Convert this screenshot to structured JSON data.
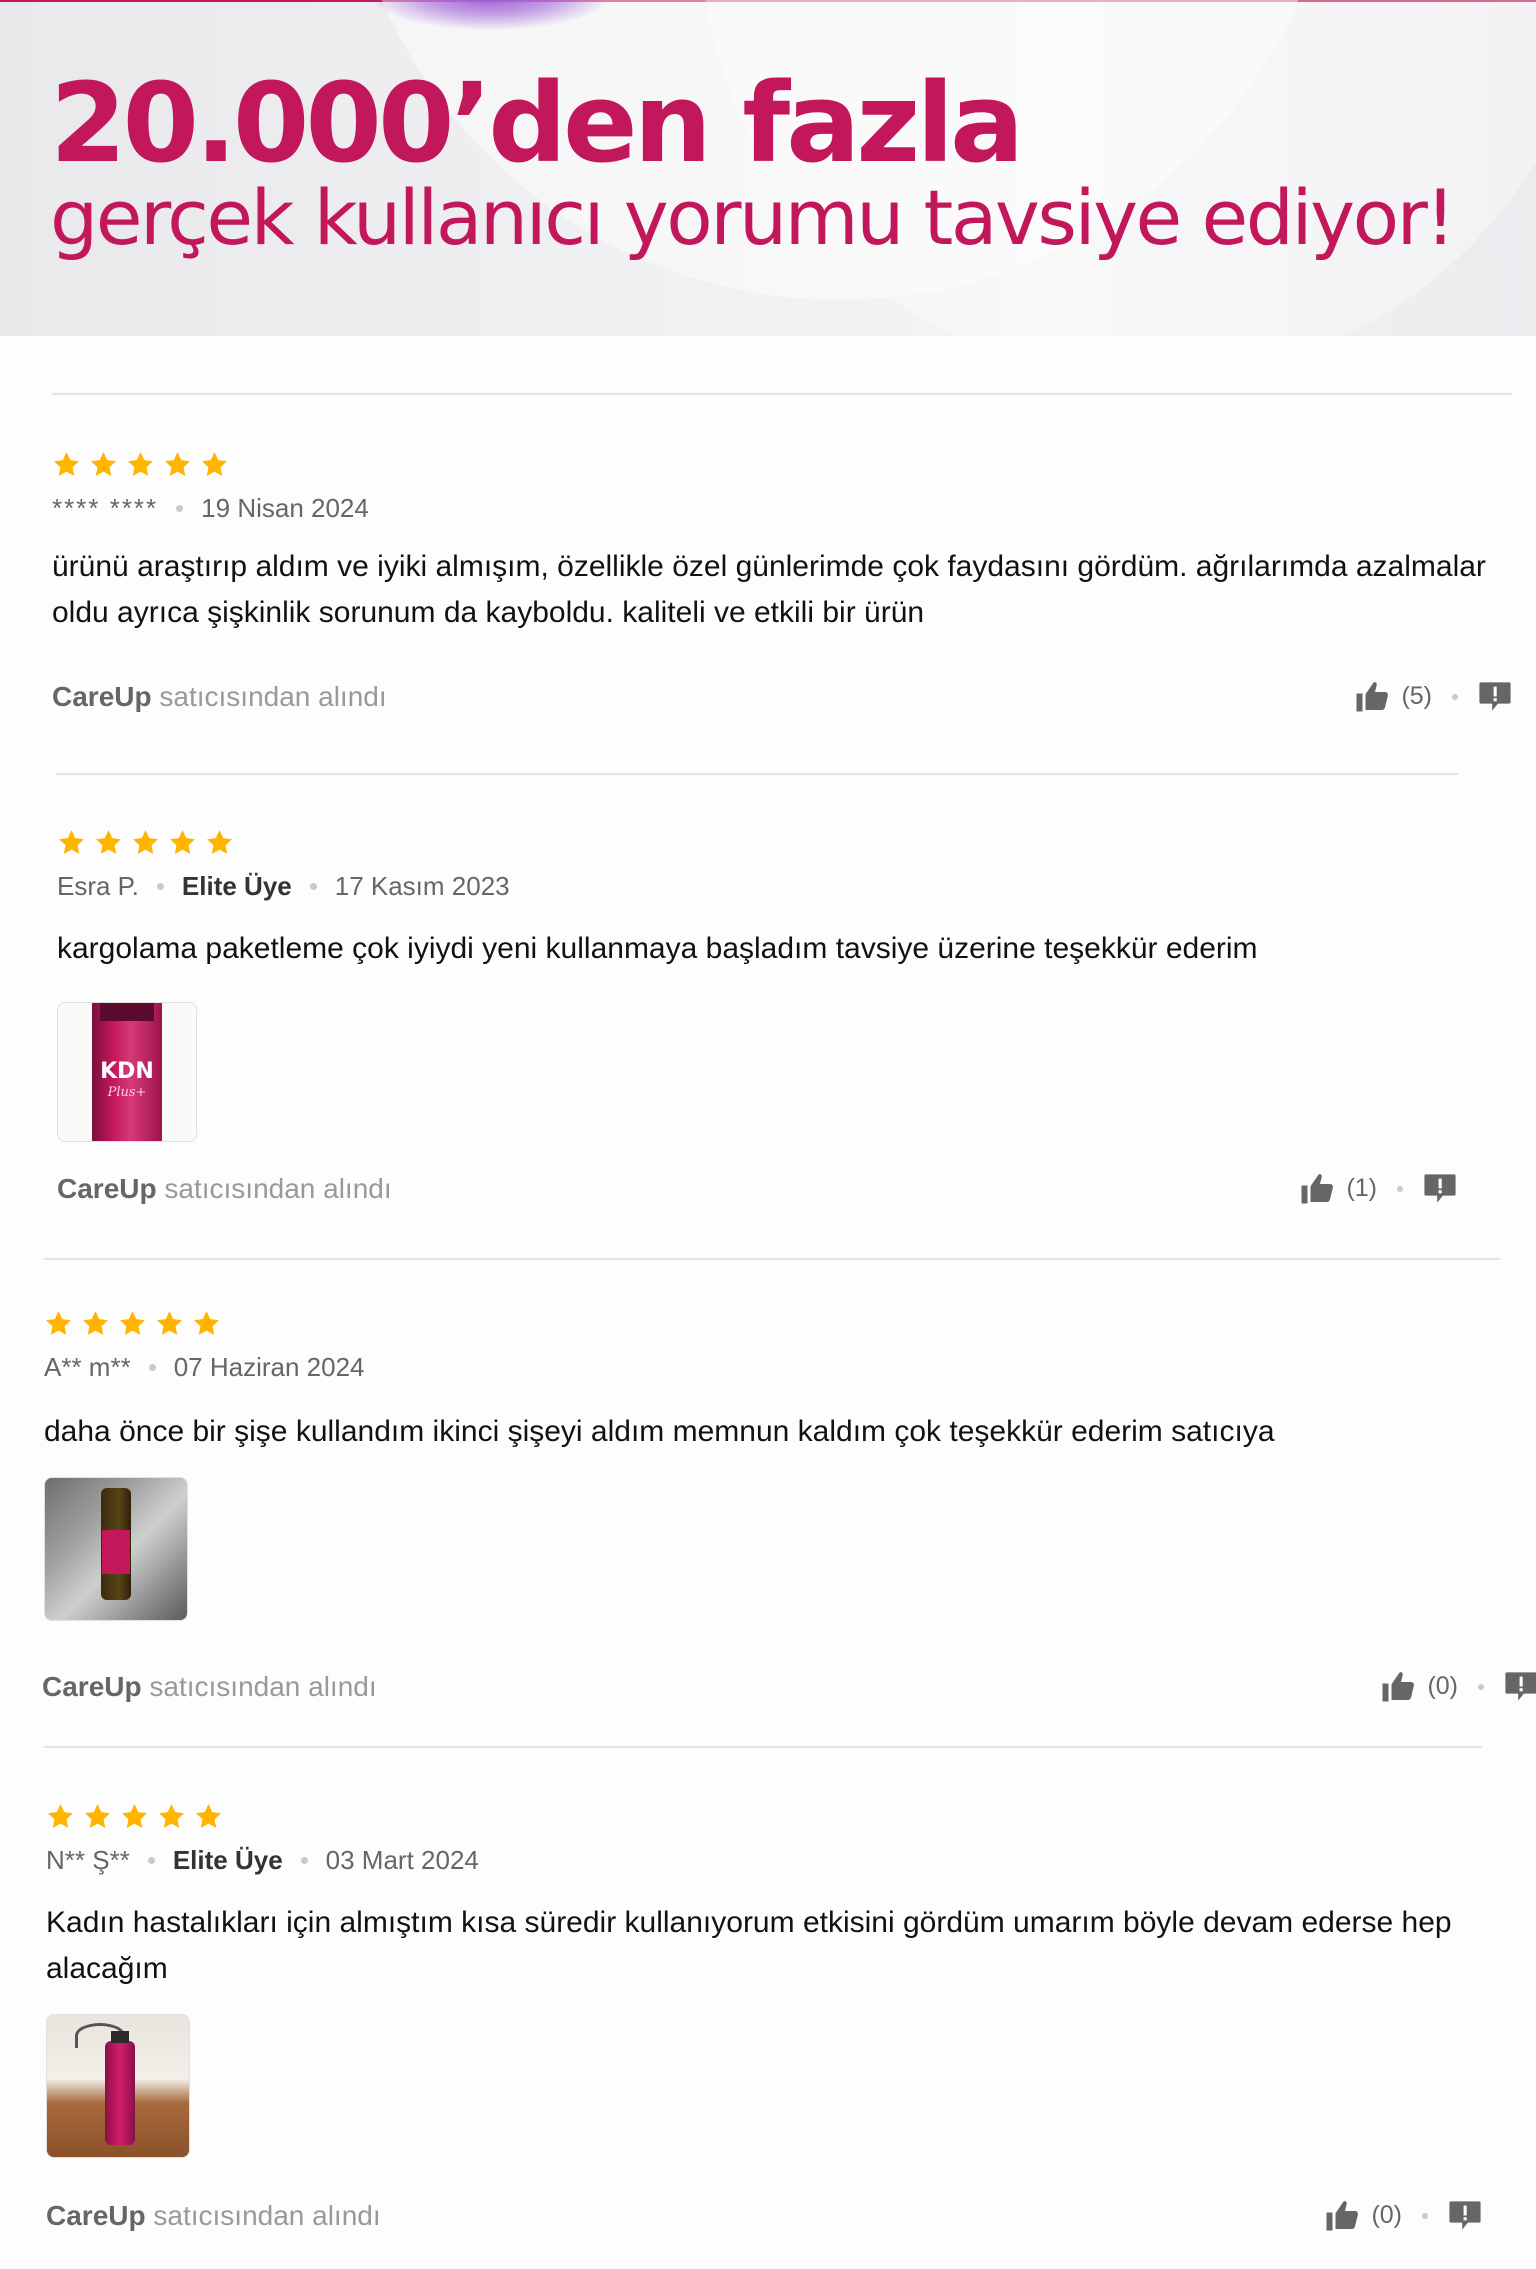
{
  "banner": {
    "title": "20.000’den fazla",
    "subtitle": "gerçek kullanıcı yorumu tavsiye ediyor!"
  },
  "colors": {
    "accent": "#c2185b",
    "star": "#ffb400"
  },
  "reviews": [
    {
      "rating": 5,
      "author": "**** ****",
      "badge": "",
      "date": "19 Nisan 2024",
      "comment": "ürünü araştırıp aldım ve iyiki almışım, özellikle özel günlerimde çok faydasını gördüm. ağrılarımda azalmalar oldu ayrıca şişkinlik sorunum da kayboldu. kaliteli ve etkili bir ürün",
      "seller": "CareUp",
      "seller_suffix": "satıcısından alındı",
      "likes": "(5)",
      "has_photo": false
    },
    {
      "rating": 5,
      "author": "Esra P.",
      "badge": "Elite Üye",
      "date": "17 Kasım 2023",
      "comment": "kargolama paketleme çok iyiydi yeni kullanmaya başladım tavsiye üzerine teşekkür ederim",
      "photo_label": "KDN",
      "photo_label2": "Plus+",
      "seller": "CareUp",
      "seller_suffix": "satıcısından alındı",
      "likes": "(1)",
      "has_photo": true
    },
    {
      "rating": 5,
      "author": "A** m**",
      "badge": "",
      "date": "07 Haziran 2024",
      "comment": "daha önce bir şişe kullandım ikinci şişeyi aldım memnun kaldım çok teşekkür ederim satıcıya",
      "seller": "CareUp",
      "seller_suffix": "satıcısından alındı",
      "likes": "(0)",
      "has_photo": true
    },
    {
      "rating": 5,
      "author": "N** Ş**",
      "badge": "Elite Üye",
      "date": "03 Mart 2024",
      "comment": "Kadın hastalıkları için almıştım kısa süredir kullanıyorum etkisini gördüm umarım böyle devam ederse hep alacağım",
      "seller": "CareUp",
      "seller_suffix": "satıcısından alındı",
      "likes": "(0)",
      "has_photo": true
    }
  ]
}
